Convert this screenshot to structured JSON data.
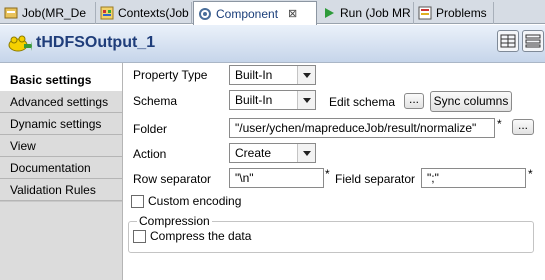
{
  "tabs": [
    {
      "label": "Job(MR_De",
      "icon": "job-icon"
    },
    {
      "label": "Contexts(Job",
      "icon": "contexts-icon"
    },
    {
      "label": "Component",
      "icon": "component-icon",
      "close": "⊠"
    },
    {
      "label": "Run (Job MR",
      "icon": "run-icon"
    },
    {
      "label": "Problems",
      "icon": "problems-icon"
    }
  ],
  "title": "tHDFSOutput_1",
  "nav": [
    {
      "label": "Basic settings"
    },
    {
      "label": "Advanced settings"
    },
    {
      "label": "Dynamic settings"
    },
    {
      "label": "View"
    },
    {
      "label": "Documentation"
    },
    {
      "label": "Validation Rules"
    }
  ],
  "form": {
    "property_type_label": "Property Type",
    "property_type_value": "Built-In",
    "schema_label": "Schema",
    "schema_value": "Built-In",
    "edit_schema_label": "Edit schema",
    "ellipsis": "...",
    "sync_columns_label": "Sync columns",
    "folder_label": "Folder",
    "folder_value": "\"/user/ychen/mapreduceJob/result/normalize\"",
    "required_mark": "*",
    "action_label": "Action",
    "action_value": "Create",
    "row_sep_label": "Row separator",
    "row_sep_value": "\"\\n\"",
    "field_sep_label": "Field separator",
    "field_sep_value": "\";\"",
    "custom_encoding_label": "Custom encoding",
    "compression_legend": "Compression",
    "compress_label": "Compress the data"
  },
  "colors": {
    "title": "#1f3d7a",
    "active_tab_text": "#1a3e7a"
  }
}
